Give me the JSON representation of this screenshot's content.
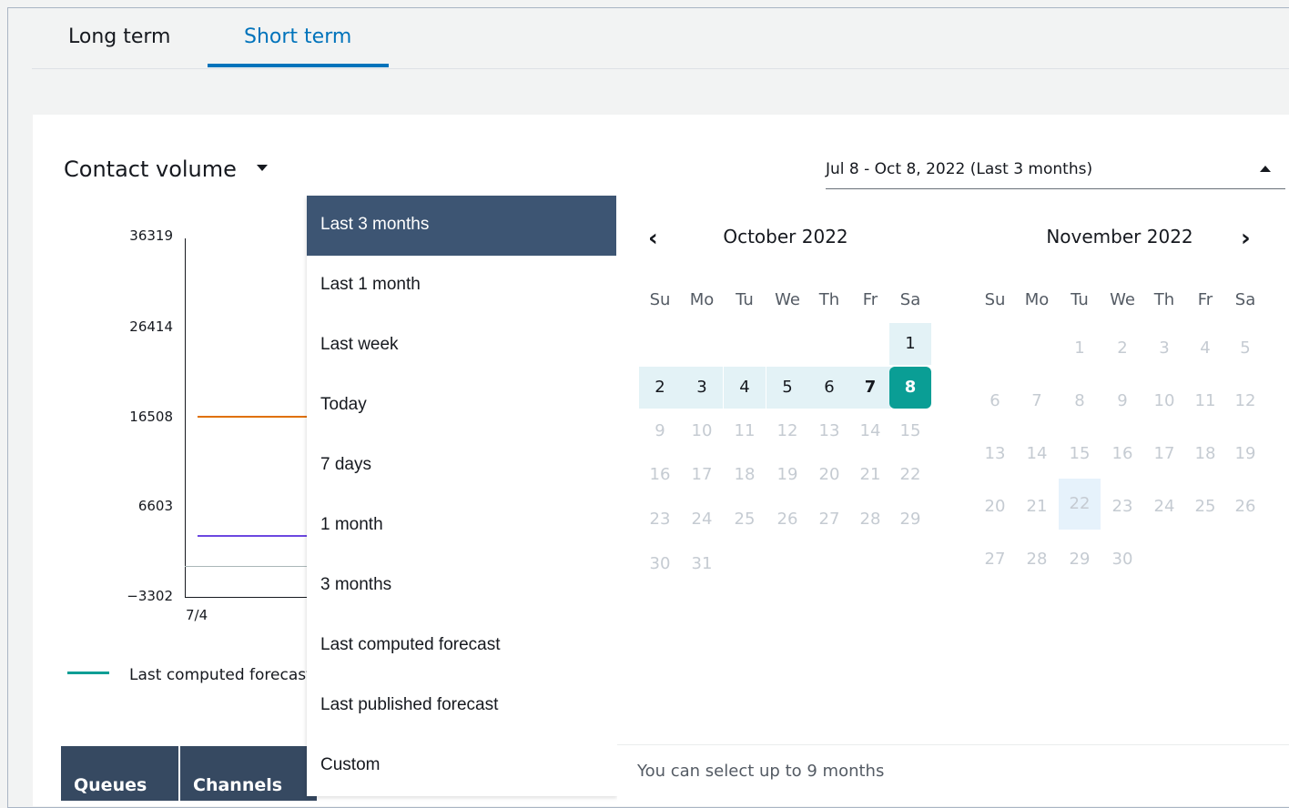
{
  "tabs": [
    {
      "label": "Long term"
    },
    {
      "label": "Short term",
      "active": true
    }
  ],
  "metric": {
    "label": "Contact volume"
  },
  "date_range": {
    "value": "Jul 8 - Oct 8, 2022 (Last 3 months)"
  },
  "chart": {
    "yticks": [
      "36319",
      "26414",
      "16508",
      "6603",
      "−3302"
    ],
    "xtick": "7/4",
    "legend": "Last computed forecast",
    "series_colors": [
      "#e07000",
      "#6c48e0"
    ],
    "legend_color": "#0a9e95"
  },
  "table_headers": [
    "Queues",
    "Channels"
  ],
  "menu": {
    "items": [
      "Last 3 months",
      "Last 1 month",
      "Last week",
      "Today",
      "7 days",
      "1 month",
      "3 months",
      "Last computed forecast",
      "Last published forecast",
      "Custom"
    ],
    "selected": "Last 3 months"
  },
  "calendar": {
    "weekdays": [
      "Su",
      "Mo",
      "Tu",
      "We",
      "Th",
      "Fr",
      "Sa"
    ],
    "left_month": "October 2022",
    "right_month": "November 2022",
    "prev_icon": "chevron-left-icon",
    "next_icon": "chevron-right-icon",
    "footer": "You can select up to 9 months",
    "selected_day": "8",
    "october": [
      [
        "",
        "",
        "",
        "",
        "",
        "",
        "1"
      ],
      [
        "2",
        "3",
        "4",
        "5",
        "6",
        "7",
        "8"
      ],
      [
        "9",
        "10",
        "11",
        "12",
        "13",
        "14",
        "15"
      ],
      [
        "16",
        "17",
        "18",
        "19",
        "20",
        "21",
        "22"
      ],
      [
        "23",
        "24",
        "25",
        "26",
        "27",
        "28",
        "29"
      ],
      [
        "30",
        "31",
        "",
        "",
        "",
        "",
        ""
      ]
    ],
    "november": [
      [
        "",
        "",
        "1",
        "2",
        "3",
        "4",
        "5"
      ],
      [
        "6",
        "7",
        "8",
        "9",
        "10",
        "11",
        "12"
      ],
      [
        "13",
        "14",
        "15",
        "16",
        "17",
        "18",
        "19"
      ],
      [
        "20",
        "21",
        "22",
        "23",
        "24",
        "25",
        "26"
      ],
      [
        "27",
        "28",
        "29",
        "30",
        "",
        "",
        ""
      ]
    ]
  },
  "colors": {
    "accent": "#0073bb",
    "selected_menu": "#3d5573",
    "range_fill": "#e3f2f6",
    "selected_day": "#0a9e95",
    "table_header": "#364961"
  }
}
